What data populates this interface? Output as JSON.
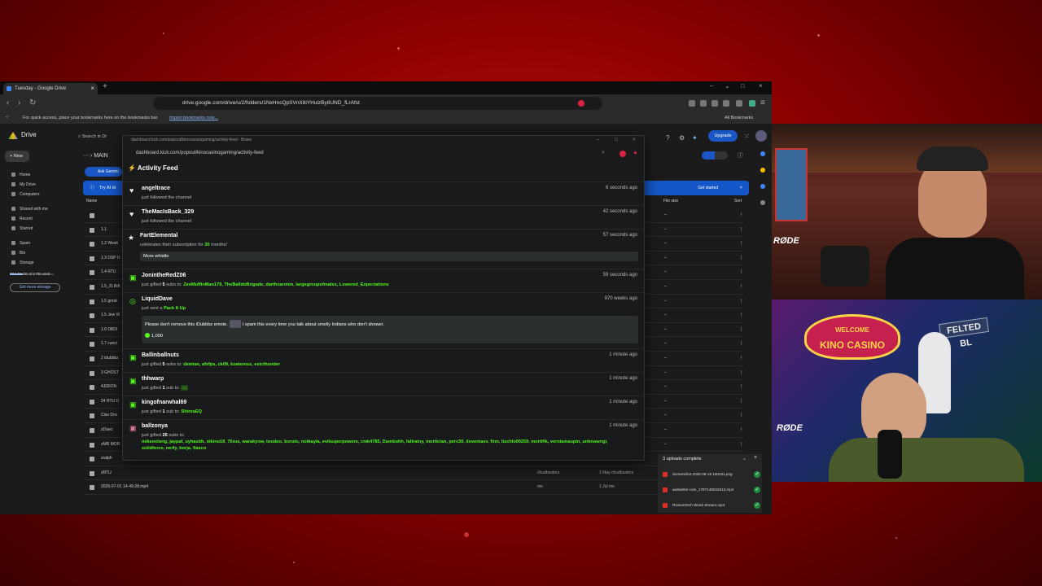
{
  "browser": {
    "tab_title": "Tuesday - Google Drive",
    "url": "drive.google.com/drive/u/2/folders/1NxHncQpSVnX8iYHulzBy8UND_fLrAfst",
    "bookmarks_hint": "For quick access, place your bookmarks here on the bookmarks bar.",
    "import_link": "Import bookmarks now...",
    "all_bookmarks": "All Bookmarks"
  },
  "drive": {
    "app_name": "Drive",
    "new_label": "New",
    "search_placeholder": "Search in Dr",
    "upgrade_label": "Upgrade",
    "breadcrumb": "MAIN",
    "ask_gemini": "Ask Gemini",
    "banner_text": "Try AI dr",
    "get_started": "Get started",
    "sidebar": [
      "Home",
      "My Drive",
      "Computers",
      "Shared with me",
      "Recent",
      "Starred",
      "Spam",
      "Bin",
      "Storage"
    ],
    "storage_text": "734.48 GB of 2 TB used",
    "get_more_storage": "Get more storage",
    "columns": {
      "name": "Name",
      "file_size": "File size",
      "sort": "Sort"
    },
    "files": [
      {
        "name": "",
        "dash": "–"
      },
      {
        "name": "1.1",
        "dash": "–"
      },
      {
        "name": "1.2 Weah",
        "dash": "–"
      },
      {
        "name": "1.3 DSP U",
        "dash": "–"
      },
      {
        "name": "1.4 RTU",
        "dash": "–"
      },
      {
        "name": "1.5_ZLINK",
        "dash": "–"
      },
      {
        "name": "1.5 great",
        "dash": "–"
      },
      {
        "name": "1.5 Jew W",
        "dash": "–"
      },
      {
        "name": "1.6 DBDI",
        "dash": "–"
      },
      {
        "name": "1.7 canci",
        "dash": "–"
      },
      {
        "name": "2 idubbbz",
        "dash": "–"
      },
      {
        "name": "3 GHOST",
        "dash": "–"
      },
      {
        "name": "4JIDION",
        "dash": "–"
      },
      {
        "name": "24 RTU D",
        "dash": "–"
      },
      {
        "name": "Clav Doc",
        "dash": "–"
      },
      {
        "name": "zDavo",
        "dash": "–"
      },
      {
        "name": "zMR MOR",
        "dash": "–"
      },
      {
        "name": "zralph",
        "dash": "–"
      },
      {
        "name": "zRTU",
        "owner": "chudbusters",
        "modified": "1 May chudbusters",
        "dash": "–"
      },
      {
        "name": "2026-07-01 14-49-28.mp4",
        "owner": "me",
        "modified": "1 Jul me",
        "dash": "–"
      }
    ],
    "uploads": {
      "header": "3 uploads complete",
      "items": [
        "Screenshot 2026-08-19 160431.png",
        "aastwitter.com_1787148032512.mp4",
        "ReviewTech Weed Stream.mp4"
      ]
    }
  },
  "popup": {
    "window_title": "dashboard.kick.com/popout/kinocasinogaming/activity-feed - Brave",
    "url": "dashboard.kick.com/popout/kinocasinogaming/activity-feed",
    "header": "Activity Feed",
    "events": [
      {
        "user": "angeltrace",
        "action": "just followed the channel",
        "time": "6 seconds ago"
      },
      {
        "user": "TheMacIsBack_329",
        "action": "just followed the channel",
        "time": "42 seconds ago"
      },
      {
        "user": "FartElemental",
        "action_pre": "celebrates their subscription for ",
        "action_num": "30",
        "action_post": " months!",
        "message": "More whistle",
        "time": "57 seconds ago"
      },
      {
        "user": "JonintheRedZ06",
        "action_pre": "just gifted ",
        "count": "5",
        "action_post": " subs to: ",
        "recipients": "ZeeMuffinMan179, TheBalldoBrigade, darthxarvion, largegroupofmales, Lowered_Expectations",
        "time": "59 seconds ago"
      },
      {
        "user": "LiquidDave",
        "action_pre": "just sent a ",
        "item": "Pack It Up",
        "message_a": "Please don't remove this iDubbbz emote.",
        "message_b": "I spam this every time you talk about smelly Indians who don't shower.",
        "amount": "1,000",
        "time": "970 weeks ago"
      },
      {
        "user": "Ballinballnuts",
        "action_pre": "just gifted ",
        "count": "5",
        "action_post": " subs to: ",
        "recipients": "demian, afxfps, ck09, koateress, esicthunder",
        "time": "1 minute ago"
      },
      {
        "user": "thhwarp",
        "action_pre": "just gifted ",
        "count": "1",
        "action_post": " sub to: ",
        "recipients": "▒▒",
        "time": "1 minute ago"
      },
      {
        "user": "kingofnarwhal69",
        "action_pre": "just gifted ",
        "count": "1",
        "action_post": " sub to: ",
        "recipients": "ShinraEQ",
        "time": "1 minute ago"
      },
      {
        "user": "ballzonya",
        "action_pre": "just gifted ",
        "count": "25",
        "action_post": " subs to:",
        "recipients": "mikeoxlong, jaypaf, uyhasbh, nikino19, 76rus, warakyow, toodoo, boruto, notkayla, evilsuperpowers, cmk4785, Dumbohh, fallrainy, mortician, perc30, ilovemavv, firm, itzchlo00259, mortifik, verniamaupin, unknowngi, solidforce, nerfy, borja, fiasco",
        "time": "1 minute ago"
      }
    ]
  },
  "webcam": {
    "sign_welcome": "WELCOME",
    "sign_casino": "KINO CASINO",
    "street_sign": "FELTED",
    "mic_brand": "RØDE"
  },
  "colors": {
    "kick_green": "#53fc18",
    "drive_blue": "#1557c8",
    "bg_red": "#c40f0f"
  }
}
